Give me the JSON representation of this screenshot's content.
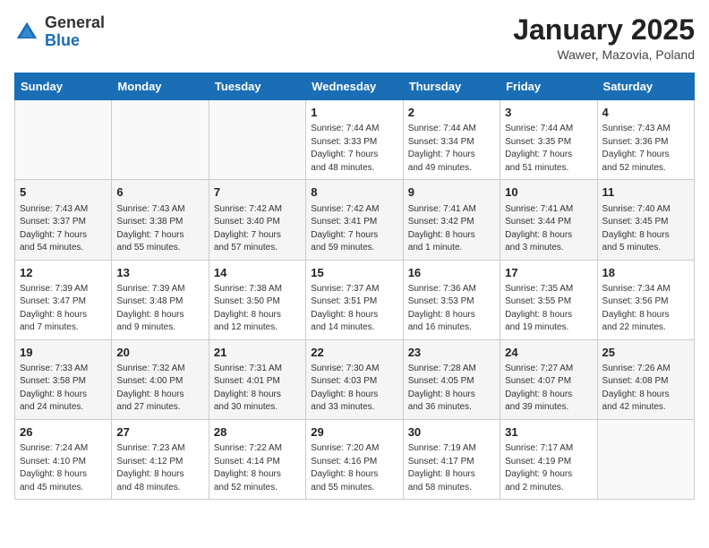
{
  "header": {
    "logo_general": "General",
    "logo_blue": "Blue",
    "month_title": "January 2025",
    "subtitle": "Wawer, Mazovia, Poland"
  },
  "weekdays": [
    "Sunday",
    "Monday",
    "Tuesday",
    "Wednesday",
    "Thursday",
    "Friday",
    "Saturday"
  ],
  "weeks": [
    [
      {
        "day": "",
        "info": ""
      },
      {
        "day": "",
        "info": ""
      },
      {
        "day": "",
        "info": ""
      },
      {
        "day": "1",
        "info": "Sunrise: 7:44 AM\nSunset: 3:33 PM\nDaylight: 7 hours\nand 48 minutes."
      },
      {
        "day": "2",
        "info": "Sunrise: 7:44 AM\nSunset: 3:34 PM\nDaylight: 7 hours\nand 49 minutes."
      },
      {
        "day": "3",
        "info": "Sunrise: 7:44 AM\nSunset: 3:35 PM\nDaylight: 7 hours\nand 51 minutes."
      },
      {
        "day": "4",
        "info": "Sunrise: 7:43 AM\nSunset: 3:36 PM\nDaylight: 7 hours\nand 52 minutes."
      }
    ],
    [
      {
        "day": "5",
        "info": "Sunrise: 7:43 AM\nSunset: 3:37 PM\nDaylight: 7 hours\nand 54 minutes."
      },
      {
        "day": "6",
        "info": "Sunrise: 7:43 AM\nSunset: 3:38 PM\nDaylight: 7 hours\nand 55 minutes."
      },
      {
        "day": "7",
        "info": "Sunrise: 7:42 AM\nSunset: 3:40 PM\nDaylight: 7 hours\nand 57 minutes."
      },
      {
        "day": "8",
        "info": "Sunrise: 7:42 AM\nSunset: 3:41 PM\nDaylight: 7 hours\nand 59 minutes."
      },
      {
        "day": "9",
        "info": "Sunrise: 7:41 AM\nSunset: 3:42 PM\nDaylight: 8 hours\nand 1 minute."
      },
      {
        "day": "10",
        "info": "Sunrise: 7:41 AM\nSunset: 3:44 PM\nDaylight: 8 hours\nand 3 minutes."
      },
      {
        "day": "11",
        "info": "Sunrise: 7:40 AM\nSunset: 3:45 PM\nDaylight: 8 hours\nand 5 minutes."
      }
    ],
    [
      {
        "day": "12",
        "info": "Sunrise: 7:39 AM\nSunset: 3:47 PM\nDaylight: 8 hours\nand 7 minutes."
      },
      {
        "day": "13",
        "info": "Sunrise: 7:39 AM\nSunset: 3:48 PM\nDaylight: 8 hours\nand 9 minutes."
      },
      {
        "day": "14",
        "info": "Sunrise: 7:38 AM\nSunset: 3:50 PM\nDaylight: 8 hours\nand 12 minutes."
      },
      {
        "day": "15",
        "info": "Sunrise: 7:37 AM\nSunset: 3:51 PM\nDaylight: 8 hours\nand 14 minutes."
      },
      {
        "day": "16",
        "info": "Sunrise: 7:36 AM\nSunset: 3:53 PM\nDaylight: 8 hours\nand 16 minutes."
      },
      {
        "day": "17",
        "info": "Sunrise: 7:35 AM\nSunset: 3:55 PM\nDaylight: 8 hours\nand 19 minutes."
      },
      {
        "day": "18",
        "info": "Sunrise: 7:34 AM\nSunset: 3:56 PM\nDaylight: 8 hours\nand 22 minutes."
      }
    ],
    [
      {
        "day": "19",
        "info": "Sunrise: 7:33 AM\nSunset: 3:58 PM\nDaylight: 8 hours\nand 24 minutes."
      },
      {
        "day": "20",
        "info": "Sunrise: 7:32 AM\nSunset: 4:00 PM\nDaylight: 8 hours\nand 27 minutes."
      },
      {
        "day": "21",
        "info": "Sunrise: 7:31 AM\nSunset: 4:01 PM\nDaylight: 8 hours\nand 30 minutes."
      },
      {
        "day": "22",
        "info": "Sunrise: 7:30 AM\nSunset: 4:03 PM\nDaylight: 8 hours\nand 33 minutes."
      },
      {
        "day": "23",
        "info": "Sunrise: 7:28 AM\nSunset: 4:05 PM\nDaylight: 8 hours\nand 36 minutes."
      },
      {
        "day": "24",
        "info": "Sunrise: 7:27 AM\nSunset: 4:07 PM\nDaylight: 8 hours\nand 39 minutes."
      },
      {
        "day": "25",
        "info": "Sunrise: 7:26 AM\nSunset: 4:08 PM\nDaylight: 8 hours\nand 42 minutes."
      }
    ],
    [
      {
        "day": "26",
        "info": "Sunrise: 7:24 AM\nSunset: 4:10 PM\nDaylight: 8 hours\nand 45 minutes."
      },
      {
        "day": "27",
        "info": "Sunrise: 7:23 AM\nSunset: 4:12 PM\nDaylight: 8 hours\nand 48 minutes."
      },
      {
        "day": "28",
        "info": "Sunrise: 7:22 AM\nSunset: 4:14 PM\nDaylight: 8 hours\nand 52 minutes."
      },
      {
        "day": "29",
        "info": "Sunrise: 7:20 AM\nSunset: 4:16 PM\nDaylight: 8 hours\nand 55 minutes."
      },
      {
        "day": "30",
        "info": "Sunrise: 7:19 AM\nSunset: 4:17 PM\nDaylight: 8 hours\nand 58 minutes."
      },
      {
        "day": "31",
        "info": "Sunrise: 7:17 AM\nSunset: 4:19 PM\nDaylight: 9 hours\nand 2 minutes."
      },
      {
        "day": "",
        "info": ""
      }
    ]
  ]
}
